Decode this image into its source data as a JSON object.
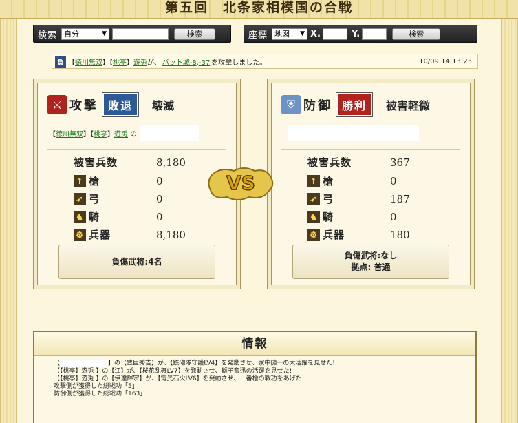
{
  "page_title": "第五回　北条家相模国の合戦",
  "search_bar": {
    "label": "検索",
    "select_value": "自分",
    "input_value": "",
    "button": "検索"
  },
  "coord_bar": {
    "label": "座標",
    "select_value": "地図",
    "x_label": "X.",
    "y_label": "Y.",
    "x_value": "",
    "y_value": "",
    "button": "検索"
  },
  "log": {
    "badge": "負",
    "b1": "【",
    "p1": "徳川無双",
    "b2": "】【",
    "p2": "桃亭",
    "b3": "】",
    "name": "遊兎",
    "t1": "が、",
    "target": "バット城-8,-37",
    "t2": "を攻撃しました。",
    "time": "10/09 14:13:23"
  },
  "attacker": {
    "role": "攻撃",
    "result": "敗退",
    "damage_level": "壊滅",
    "b1": "【",
    "clan1": "徳川無双",
    "b2": "】【",
    "clan2": "桃亭",
    "b3": "】",
    "player": "遊兎",
    "no": "の",
    "stats": {
      "loss_label": "被害兵数",
      "loss_value": "8,180",
      "spear_label": "槍",
      "spear_value": "0",
      "bow_label": "弓",
      "bow_value": "0",
      "cav_label": "騎",
      "cav_value": "0",
      "weapon_label": "兵器",
      "weapon_value": "8,180"
    },
    "injured_line1": "負傷武将:4名",
    "injured_line2": ""
  },
  "defender": {
    "role": "防御",
    "result": "勝利",
    "damage_level": "被害軽微",
    "stats": {
      "loss_label": "被害兵数",
      "loss_value": "367",
      "spear_label": "槍",
      "spear_value": "0",
      "bow_label": "弓",
      "bow_value": "187",
      "cav_label": "騎",
      "cav_value": "0",
      "weapon_label": "兵器",
      "weapon_value": "180"
    },
    "injured_line1": "負傷武将:なし",
    "injured_line2": "拠点: 普通"
  },
  "vs_text": "VS",
  "info": {
    "heading": "情報",
    "l1a": "【",
    "l1b": "】の【豊臣秀吉】が、【鉄砲隊守護LV4】を発動させ、家中随一の大活躍を見せた!",
    "l2": "【【桃亭】遊兎 】の【江】が、【桜花乱舞LV7】を発動させ、獅子奮迅の活躍を見せた!",
    "l3": "【【桃亭】遊兎 】の【伊達輝宗】が、【電光石火LV6】を発動させ、一番槍の戦功をあげた!",
    "l4": "攻撃側が獲得した総戦功「5」",
    "l5": "防御側が獲得した総戦功「163」"
  },
  "colors": {
    "lose": "#2d5a97",
    "win": "#b3231d",
    "link_green": "#1a7a1a",
    "background": "#fbf6dc"
  }
}
